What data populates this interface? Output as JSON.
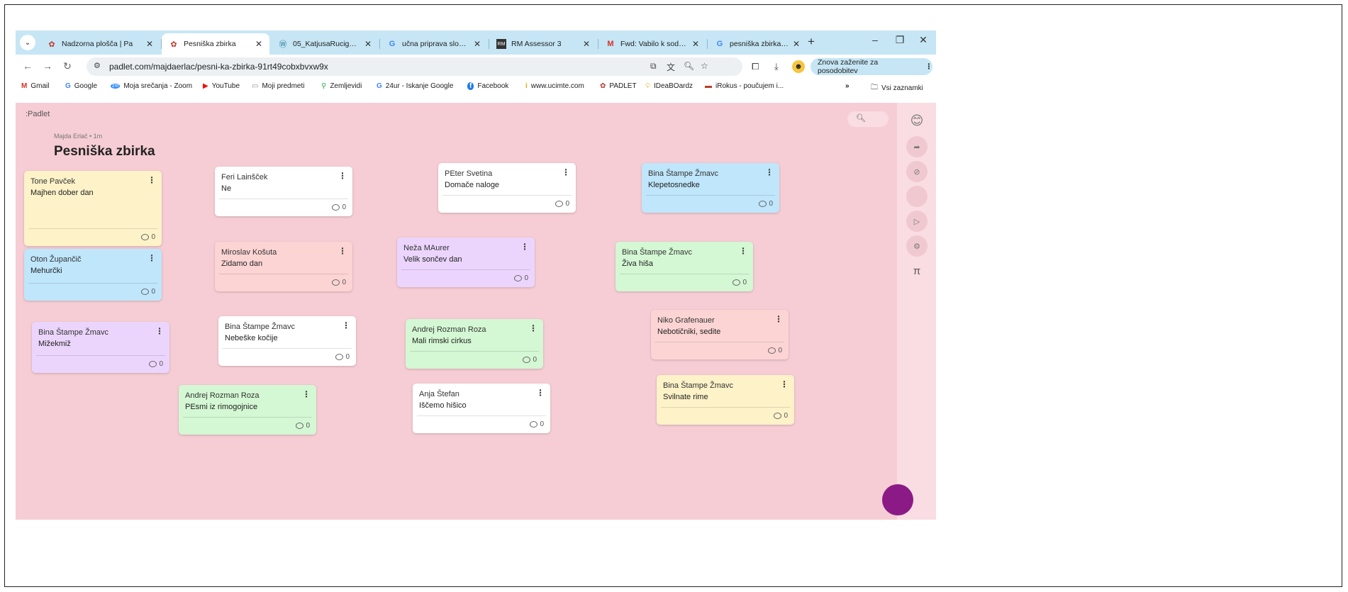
{
  "tabs": [
    {
      "title": "Nadzorna plošča | Pa",
      "icon": "padlet",
      "active": false
    },
    {
      "title": "Pesniška zbirka",
      "icon": "padlet",
      "active": true
    },
    {
      "title": "05_KatjusaRucigaj-1.p",
      "icon": "wordpress",
      "active": false
    },
    {
      "title": "učna priprava sloven",
      "icon": "google",
      "active": false
    },
    {
      "title": "RM Assessor 3",
      "icon": "rm",
      "active": false
    },
    {
      "title": "Fwd: Vabilo k sodelo",
      "icon": "gmail",
      "active": false
    },
    {
      "title": "pesniška zbirka iščem",
      "icon": "google",
      "active": false
    }
  ],
  "window": {
    "new_tab": "+",
    "minimize": "–",
    "restore": "❐",
    "close": "✕"
  },
  "address": {
    "url": "padlet.com/majdaerlac/pesni-ka-zbirka-91rt49cobxbvxw9x",
    "update_label": "Znova zaženite za posodobitev"
  },
  "bookmarks": [
    {
      "label": "Gmail",
      "icon": "M"
    },
    {
      "label": "Google",
      "icon": "G"
    },
    {
      "label": "Moja srečanja - Zoom",
      "icon": "zm"
    },
    {
      "label": "YouTube",
      "icon": "▶"
    },
    {
      "label": "Moji predmeti",
      "icon": "▭"
    },
    {
      "label": "Zemljevidi",
      "icon": "⚲"
    },
    {
      "label": "24ur - Iskanje Google",
      "icon": "G"
    },
    {
      "label": "Facebook",
      "icon": "f"
    },
    {
      "label": "www.ucimte.com",
      "icon": "i"
    },
    {
      "label": "PADLET",
      "icon": "✿"
    },
    {
      "label": "IDeaBOardz",
      "icon": "💡"
    },
    {
      "label": "iRokus - poučujem i...",
      "icon": "▬"
    }
  ],
  "bookmarks_more": "»",
  "bookmarks_all": "Vsi zaznamki",
  "padlet": {
    "logo": ":Padlet",
    "author": "Majda Erlač • 1m",
    "title": "Pesniška zbirka",
    "colors": {
      "bg": "#f6cdd4",
      "yellow": "#fdf2c8",
      "white": "#ffffff",
      "blue": "#bfe6fb",
      "pink": "#fcd4d4",
      "purple": "#ecd5fd",
      "green": "#d4f7d4"
    },
    "posts": [
      {
        "author": "Tone Pavček",
        "title": "Majhen dober dan",
        "comments": "0",
        "color": "yellow"
      },
      {
        "author": "Feri Lainšček",
        "title": "Ne",
        "comments": "0",
        "color": "white"
      },
      {
        "author": "PEter Svetina",
        "title": "Domače naloge",
        "comments": "0",
        "color": "white"
      },
      {
        "author": "Bina Štampe Žmavc",
        "title": "Klepetosnedke",
        "comments": "0",
        "color": "blue"
      },
      {
        "author": "Oton Župančič",
        "title": "Mehurčki",
        "comments": "0",
        "color": "blue"
      },
      {
        "author": "Miroslav Košuta",
        "title": "Zidamo dan",
        "comments": "0",
        "color": "pink"
      },
      {
        "author": "Neža MAurer",
        "title": "Velik sončev dan",
        "comments": "0",
        "color": "purple"
      },
      {
        "author": "Bina Štampe Žmavc",
        "title": "Živa hiša",
        "comments": "0",
        "color": "green"
      },
      {
        "author": "Bina Štampe Žmavc",
        "title": "Mižekmiž",
        "comments": "0",
        "color": "purple"
      },
      {
        "author": "Bina Štampe Žmavc",
        "title": "Nebeške kočije",
        "comments": "0",
        "color": "white"
      },
      {
        "author": "Andrej Rozman Roza",
        "title": "Mali rimski cirkus",
        "comments": "0",
        "color": "green"
      },
      {
        "author": "Niko Grafenauer",
        "title": "Nebotičniki, sedite",
        "comments": "0",
        "color": "pink"
      },
      {
        "author": "Andrej Rozman Roza",
        "title": "PEsmi iz rimogojnice",
        "comments": "0",
        "color": "green"
      },
      {
        "author": "Anja Štefan",
        "title": "Iščemo hišico",
        "comments": "0",
        "color": "white"
      },
      {
        "author": "Bina Štampe Žmavc",
        "title": "Svilnate rime",
        "comments": "0",
        "color": "yellow"
      }
    ]
  }
}
